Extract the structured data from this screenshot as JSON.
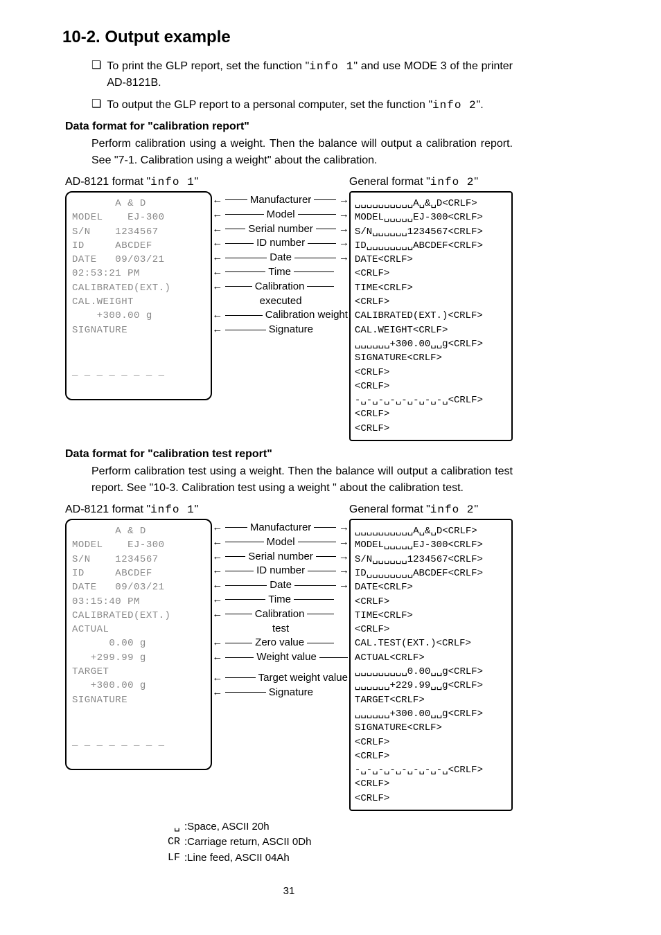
{
  "title": "10-2. Output example",
  "bullets": {
    "b1_pre": "To print the GLP report, set the function \"",
    "b1_seg": "info 1",
    "b1_post": "\" and use MODE 3 of the printer AD-8121B.",
    "b2_pre": "To output the GLP report to a personal computer, set the function \"",
    "b2_seg": "info 2",
    "b2_post": "\"."
  },
  "section1": {
    "heading": "Data format for \"calibration report\"",
    "para": "Perform calibration using a weight. Then the balance will output a calibration report. See \"7-1. Calibration using a weight\" about the calibration.",
    "fmtA_pre": "AD-8121 format \"",
    "fmtA_seg": "info 1",
    "fmtA_post": "\"",
    "fmtB_pre": "General format \"",
    "fmtB_seg": "info 2",
    "fmtB_post": "\"",
    "printout": "       A & D\nMODEL    EJ-300\nS/N    1234567\nID     ABCDEF\nDATE   09/03/21\n02:53:21 PM\nCALIBRATED(EXT.)\nCAL.WEIGHT\n    +300.00 g\nSIGNATURE\n\n\n_ _ _ _ _ _ _ _",
    "mid": {
      "m1": "Manufacturer",
      "m2": "Model",
      "m3": "Serial number",
      "m4": "ID number",
      "m5": "Date",
      "m6": "Time",
      "m7a": "Calibration",
      "m7b": "executed",
      "m8": "Calibration weight",
      "m9": "Signature"
    },
    "general": "␣␣␣␣␣␣␣␣␣␣A␣&␣D<CRLF>\nMODEL␣␣␣␣␣EJ-300<CRLF>\nS/N␣␣␣␣␣␣1234567<CRLF>\nID␣␣␣␣␣␣␣␣ABCDEF<CRLF>\nDATE<CRLF>\n<CRLF>\nTIME<CRLF>\n<CRLF>\nCALIBRATED(EXT.)<CRLF>\nCAL.WEIGHT<CRLF>\n␣␣␣␣␣␣+300.00␣␣g<CRLF>\nSIGNATURE<CRLF>\n<CRLF>\n<CRLF>\n-␣-␣-␣-␣-␣-␣-␣-␣<CRLF>\n<CRLF>\n<CRLF>"
  },
  "section2": {
    "heading": "Data format for \"calibration test report\"",
    "para": "Perform calibration test using a weight. Then the balance will output a calibration test report. See \"10-3. Calibration test using a weight \" about the calibration test.",
    "fmtA_pre": "AD-8121 format \"",
    "fmtA_seg": "info 1",
    "fmtA_post": "\"",
    "fmtB_pre": "General format \"",
    "fmtB_seg": "info 2",
    "fmtB_post": "\"",
    "printout": "       A & D\nMODEL    EJ-300\nS/N    1234567\nID     ABCDEF\nDATE   09/03/21\n03:15:40 PM\nCALIBRATED(EXT.)\nACTUAL\n      0.00 g\n   +299.99 g\nTARGET\n   +300.00 g\nSIGNATURE\n\n\n_ _ _ _ _ _ _ _",
    "mid": {
      "m1": "Manufacturer",
      "m2": "Model",
      "m3": "Serial number",
      "m4": "ID number",
      "m5": "Date",
      "m6": "Time",
      "m7a": "Calibration",
      "m7b": "test",
      "m8": "Zero value",
      "m9": "Weight value",
      "m10": "Target weight value",
      "m11": "Signature"
    },
    "general": "␣␣␣␣␣␣␣␣␣␣A␣&␣D<CRLF>\nMODEL␣␣␣␣␣EJ-300<CRLF>\nS/N␣␣␣␣␣␣1234567<CRLF>\nID␣␣␣␣␣␣␣␣ABCDEF<CRLF>\nDATE<CRLF>\n<CRLF>\nTIME<CRLF>\n<CRLF>\nCAL.TEST(EXT.)<CRLF>\nACTUAL<CRLF>\n␣␣␣␣␣␣␣␣␣0.00␣␣g<CRLF>\n␣␣␣␣␣␣+229.99␣␣g<CRLF>\nTARGET<CRLF>\n␣␣␣␣␣␣+300.00␣␣g<CRLF>\nSIGNATURE<CRLF>\n<CRLF>\n<CRLF>\n-␣-␣-␣-␣-␣-␣-␣-␣<CRLF>\n<CRLF>\n<CRLF>"
  },
  "legend": {
    "k1": "␣",
    "v1": ":Space, ASCII 20h",
    "k2": "CR",
    "v2": ":Carriage return, ASCII 0Dh",
    "k3": "LF",
    "v3": ":Line feed, ASCII 04Ah"
  },
  "pagenum": "31"
}
